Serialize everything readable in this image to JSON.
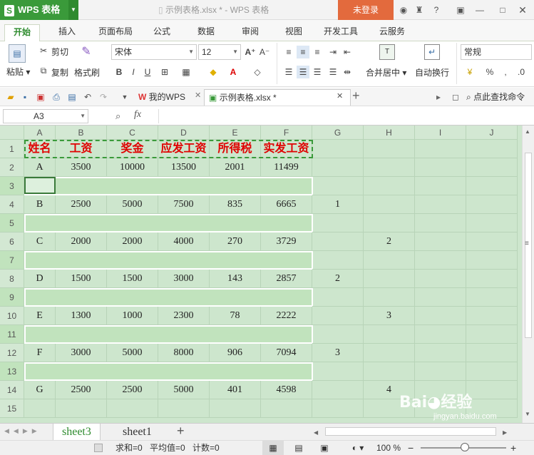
{
  "app": {
    "name": "WPS 表格",
    "doc_title": "示例表格.xlsx * - WPS 表格",
    "login": "未登录"
  },
  "menu": [
    "开始",
    "插入",
    "页面布局",
    "公式",
    "数据",
    "审阅",
    "视图",
    "开发工具",
    "云服务"
  ],
  "ribbon": {
    "paste": "粘贴",
    "cut": "剪切",
    "copy": "复制",
    "format_painter": "格式刷",
    "font": "宋体",
    "size": "12",
    "merge": "合并居中",
    "wrap": "自动换行",
    "number_format": "常规"
  },
  "quickbar": {
    "tab_wps": "我的WPS",
    "tab_doc": "示例表格.xlsx *",
    "search": "点此查找命令"
  },
  "formula": {
    "cell_ref": "A3",
    "fx": "fx"
  },
  "columns": [
    "A",
    "B",
    "C",
    "D",
    "E",
    "F",
    "G",
    "H",
    "I",
    "J"
  ],
  "rows": [
    [
      "姓名",
      "工资",
      "奖金",
      "应发工资",
      "所得税",
      "实发工资",
      "",
      ""
    ],
    [
      "A",
      "3500",
      "10000",
      "13500",
      "2001",
      "11499",
      "",
      ""
    ],
    [
      "",
      "",
      "",
      "",
      "",
      "",
      "",
      ""
    ],
    [
      "B",
      "2500",
      "5000",
      "7500",
      "835",
      "6665",
      "1",
      ""
    ],
    [
      "",
      "",
      "",
      "",
      "",
      "",
      "",
      ""
    ],
    [
      "C",
      "2000",
      "2000",
      "4000",
      "270",
      "3729",
      "",
      "2"
    ],
    [
      "",
      "",
      "",
      "",
      "",
      "",
      "",
      ""
    ],
    [
      "D",
      "1500",
      "1500",
      "3000",
      "143",
      "2857",
      "2",
      ""
    ],
    [
      "",
      "",
      "",
      "",
      "",
      "",
      "",
      ""
    ],
    [
      "E",
      "1300",
      "1000",
      "2300",
      "78",
      "2222",
      "",
      "3"
    ],
    [
      "",
      "",
      "",
      "",
      "",
      "",
      "",
      ""
    ],
    [
      "F",
      "3000",
      "5000",
      "8000",
      "906",
      "7094",
      "3",
      ""
    ],
    [
      "",
      "",
      "",
      "",
      "",
      "",
      "",
      ""
    ],
    [
      "G",
      "2500",
      "2500",
      "5000",
      "401",
      "4598",
      "",
      "4"
    ],
    [
      "",
      "",
      "",
      "",
      "",
      "",
      "",
      ""
    ]
  ],
  "sheets": [
    "sheet3",
    "sheet1"
  ],
  "status": {
    "sum": "求和=0",
    "avg": "平均值=0",
    "count": "计数=0",
    "zoom": "100 %"
  },
  "watermark": "jingyan.baidu.com",
  "colors": {
    "accent": "#3a9a3a",
    "login": "#e36a3d",
    "header_text": "#e00000",
    "grid_bg": "#cde6cd"
  }
}
